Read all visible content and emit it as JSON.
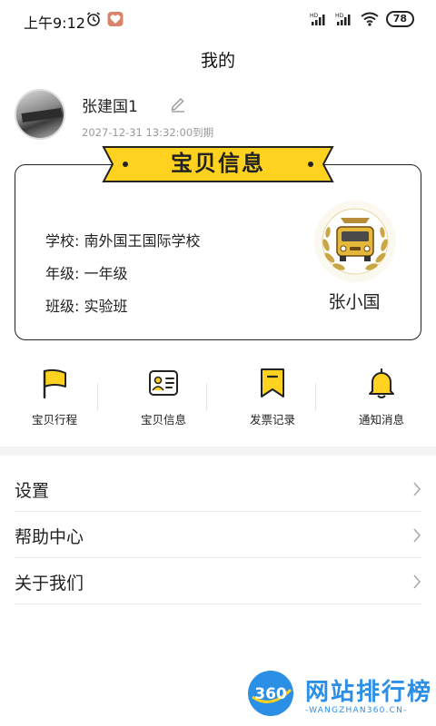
{
  "status_bar": {
    "time": "上午9:12",
    "battery": "78",
    "network_1": "HD",
    "network_2": "HD"
  },
  "header": {
    "title": "我的"
  },
  "profile": {
    "name": "张建国1",
    "expiry": "2027-12-31 13:32:00到期"
  },
  "baby_card": {
    "title": "宝贝信息",
    "school": "学校: 南外国王国际学校",
    "grade": "年级: 一年级",
    "class": "班级: 实验班",
    "child_name": "张小国"
  },
  "quick_menu": [
    {
      "label": "宝贝行程",
      "icon": "flag-icon"
    },
    {
      "label": "宝贝信息",
      "icon": "id-card-icon"
    },
    {
      "label": "发票记录",
      "icon": "bookmark-icon"
    },
    {
      "label": "通知消息",
      "icon": "bell-icon"
    }
  ],
  "menu_list": [
    {
      "label": "设置"
    },
    {
      "label": "帮助中心"
    },
    {
      "label": "关于我们"
    }
  ],
  "watermark": {
    "logo_text": "360",
    "title": "网站排行榜",
    "subtitle": "-WANGZHAN360.CN-"
  },
  "colors": {
    "accent_yellow": "#FFD21F",
    "watermark_blue": "#2B8FE6",
    "divider": "#ECECEC"
  }
}
